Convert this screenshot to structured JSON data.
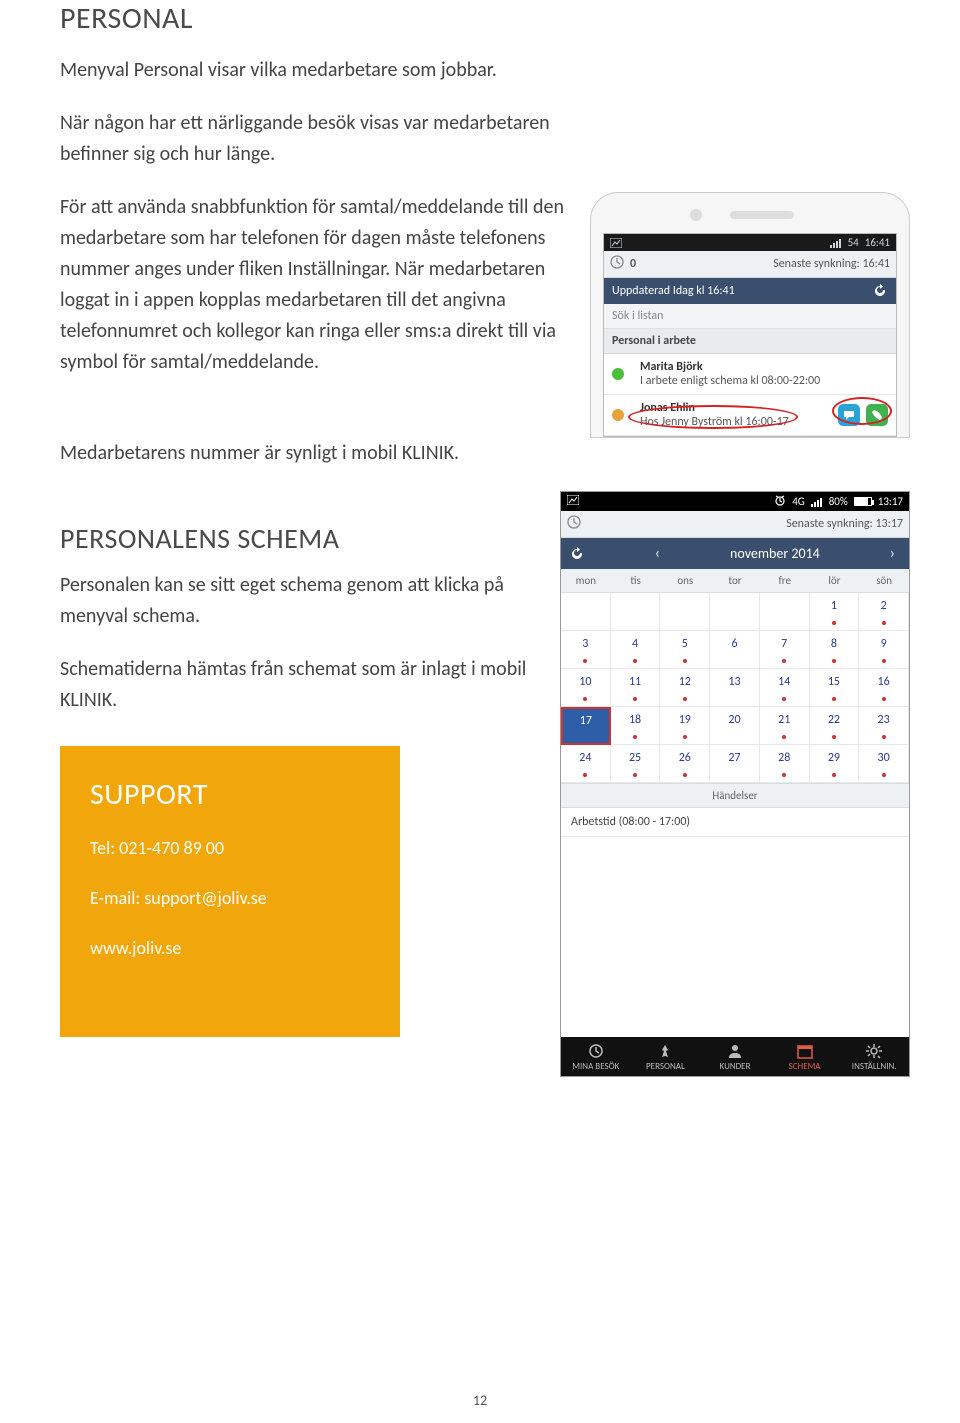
{
  "title_section1": "PERSONAL",
  "para1": "Menyval Personal visar vilka medarbetare som jobbar.",
  "para2": "När någon har ett närliggande besök visas var medarbetaren befinner sig och hur länge.",
  "para3": "För att använda snabbfunktion för samtal/meddelande till den medarbetare som har telefonen för dagen måste telefonens nummer anges under fliken Inställningar. När medarbetaren loggat in i appen kopplas medarbetaren till det angivna telefonnumret och kollegor kan ringa eller sms:a direkt till via symbol för samtal/meddelande.",
  "para4": "Medarbetarens nummer är synligt i mobil KLINIK.",
  "title_section2": "PERSONALENS SCHEMA",
  "para5": "Personalen kan se sitt eget schema genom att klicka på menyval schema.",
  "para6": "Schematiderna hämtas från schemat som är inlagt i mobil KLINIK.",
  "support": {
    "title": "SUPPORT",
    "tel_label": "Tel: 021-470 89 00",
    "email_label": "E-mail: support@joliv.se",
    "web": "www.joliv.se"
  },
  "phone1": {
    "status": {
      "signal_label": "54",
      "clock": "16:41"
    },
    "sync_count": "0",
    "sync_text": "Senaste synkning: 16:41",
    "bluebar_text": "Uppdaterad Idag kl 16:41",
    "search_placeholder": "Sök i listan",
    "header": "Personal i arbete",
    "rows": [
      {
        "name": "Marita Björk",
        "sub": "I arbete enligt schema kl 08:00-22:00",
        "status": "green",
        "has_btns": false
      },
      {
        "name": "Jonas Ehlin",
        "sub": "Hos Jenny  Byström kl 16:00-17",
        "status": "amber",
        "has_btns": true
      }
    ]
  },
  "phone2": {
    "status": {
      "net": "4G",
      "battery": "80%",
      "clock": "13:17"
    },
    "sync_text": "Senaste synkning: 13:17",
    "month_label": "november 2014",
    "weekdays": [
      "mon",
      "tis",
      "ons",
      "tor",
      "fre",
      "lör",
      "sön"
    ],
    "days": [
      {
        "n": ""
      },
      {
        "n": ""
      },
      {
        "n": ""
      },
      {
        "n": ""
      },
      {
        "n": ""
      },
      {
        "n": "1",
        "dot": true
      },
      {
        "n": "2",
        "dot": true
      },
      {
        "n": "3",
        "dot": true
      },
      {
        "n": "4",
        "dot": true
      },
      {
        "n": "5",
        "dot": true
      },
      {
        "n": "6"
      },
      {
        "n": "7",
        "dot": true
      },
      {
        "n": "8",
        "dot": true
      },
      {
        "n": "9",
        "dot": true
      },
      {
        "n": "10",
        "dot": true
      },
      {
        "n": "11",
        "dot": true
      },
      {
        "n": "12",
        "dot": true
      },
      {
        "n": "13"
      },
      {
        "n": "14",
        "dot": true
      },
      {
        "n": "15",
        "dot": true
      },
      {
        "n": "16",
        "dot": true
      },
      {
        "n": "17",
        "today": true
      },
      {
        "n": "18",
        "dot": true
      },
      {
        "n": "19",
        "dot": true
      },
      {
        "n": "20"
      },
      {
        "n": "21",
        "dot": true
      },
      {
        "n": "22",
        "dot": true
      },
      {
        "n": "23",
        "dot": true
      },
      {
        "n": "24",
        "dot": true
      },
      {
        "n": "25",
        "dot": true
      },
      {
        "n": "26",
        "dot": true
      },
      {
        "n": "27"
      },
      {
        "n": "28",
        "dot": true
      },
      {
        "n": "29",
        "dot": true
      },
      {
        "n": "30",
        "dot": true
      }
    ],
    "events_label": "Händelser",
    "event_row": "Arbetstid (08:00 - 17:00)",
    "nav": [
      "MINA BESÖK",
      "PERSONAL",
      "KUNDER",
      "SCHEMA",
      "INSTÄLLNIN."
    ],
    "nav_active_index": 3
  },
  "page_number": "12"
}
